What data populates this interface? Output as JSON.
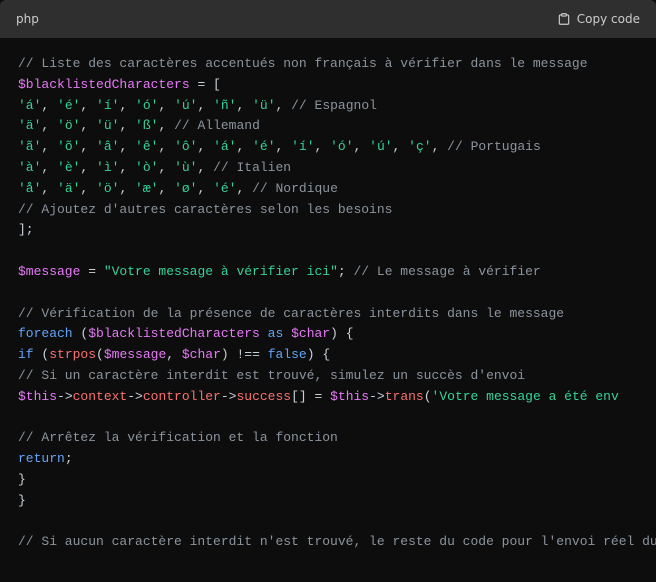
{
  "header": {
    "language": "php",
    "copy_label": "Copy code"
  },
  "code": {
    "c1": "// Liste des caractères accentués non français à vérifier dans le message",
    "v1": "$blacklistedCharacters",
    "eq1": " = [",
    "s_a1": "'á'",
    "s_a2": "'é'",
    "s_a3": "'í'",
    "s_a4": "'ó'",
    "s_a5": "'ú'",
    "s_a6": "'ñ'",
    "s_a7": "'ü'",
    "c_es": "// Espagnol",
    "s_b1": "'ä'",
    "s_b2": "'ö'",
    "s_b3": "'ü'",
    "s_b4": "'ß'",
    "c_de": "// Allemand",
    "s_c1": "'ã'",
    "s_c2": "'õ'",
    "s_c3": "'â'",
    "s_c4": "'ê'",
    "s_c5": "'ô'",
    "s_c6": "'á'",
    "s_c7": "'é'",
    "s_c8": "'í'",
    "s_c9": "'ó'",
    "s_c10": "'ú'",
    "s_c11": "'ç'",
    "c_pt": "// Portugais",
    "s_d1": "'à'",
    "s_d2": "'è'",
    "s_d3": "'ì'",
    "s_d4": "'ò'",
    "s_d5": "'ù'",
    "c_it": "// Italien",
    "s_e1": "'å'",
    "s_e2": "'ä'",
    "s_e3": "'ö'",
    "s_e4": "'æ'",
    "s_e5": "'ø'",
    "s_e6": "'é'",
    "c_no": "// Nordique",
    "c_add": "// Ajoutez d'autres caractères selon les besoins",
    "close1": "];",
    "v2": "$message",
    "msg_str": "\"Votre message à vérifier ici\"",
    "c_msg": "// Le message à vérifier",
    "c_verif": "// Vérification de la présence de caractères interdits dans le message",
    "kw_foreach": "foreach",
    "kw_as": "as",
    "v_char": "$char",
    "kw_if": "if",
    "fn_strpos": "strpos",
    "op_neq": " !== ",
    "kw_false": "false",
    "c_si": "// Si un caractère interdit est trouvé, simulez un succès d'envoi",
    "v_this": "$this",
    "p_ctx": "context",
    "p_ctrl": "controller",
    "p_succ": "success",
    "fn_trans": "trans",
    "trans_str": "'Votre message a été env",
    "c_stop": "// Arrêtez la vérification et la fonction",
    "kw_return": "return",
    "c_last": "// Si aucun caractère interdit n'est trouvé, le reste du code pour l'envoi réel du me",
    "comma": ", ",
    "semi": ";",
    "arrow": "->",
    "brack_eq": "[] = ",
    "paren_o": " (",
    "paren_c": ")",
    "brace_o": " {",
    "brace_c": "}",
    "ind1": "    ",
    "ind2": "        ",
    "ind3": "            "
  }
}
